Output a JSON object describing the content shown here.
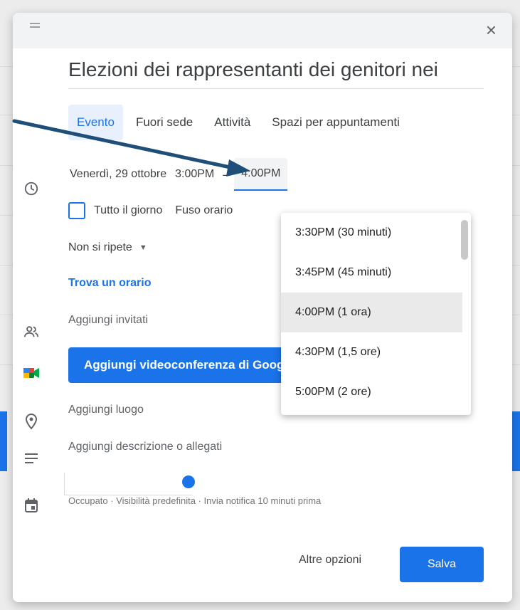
{
  "colors": {
    "accent": "#1a73e8",
    "arrow": "#1f4e79"
  },
  "header": {
    "close_label": "×"
  },
  "event": {
    "title": "Elezioni dei rappresentanti dei genitori nei"
  },
  "tabs": [
    {
      "label": "Evento",
      "active": true
    },
    {
      "label": "Fuori sede",
      "active": false
    },
    {
      "label": "Attività",
      "active": false
    },
    {
      "label": "Spazi per appuntamenti",
      "active": false
    }
  ],
  "datetime": {
    "date": "Venerdì, 29 ottobre",
    "start": "3:00PM",
    "separator": "–",
    "end": "4:00PM"
  },
  "allday": {
    "label": "Tutto il giorno",
    "timezone": "Fuso orario"
  },
  "repeat": {
    "label": "Non si ripete"
  },
  "find_time": {
    "label": "Trova un orario"
  },
  "guests": {
    "placeholder": "Aggiungi invitati"
  },
  "meet": {
    "label": "Aggiungi videoconferenza di Google Meet"
  },
  "location": {
    "placeholder": "Aggiungi luogo"
  },
  "description": {
    "placeholder": "Aggiungi descrizione o allegati"
  },
  "status": {
    "line": "Occupato · Visibilità predefinita · Invia notifica 10 minuti prima"
  },
  "footer": {
    "more_label": "Altre opzioni",
    "save_label": "Salva"
  },
  "end_time_options": [
    {
      "label": "3:30PM (30 minuti)",
      "selected": false
    },
    {
      "label": "3:45PM (45 minuti)",
      "selected": false
    },
    {
      "label": "4:00PM (1 ora)",
      "selected": true
    },
    {
      "label": "4:30PM (1,5 ore)",
      "selected": false
    },
    {
      "label": "5:00PM (2 ore)",
      "selected": false
    }
  ],
  "icons": {
    "clock": "clock-icon",
    "people": "people-icon",
    "meet": "google-meet-icon",
    "location": "location-pin-icon",
    "description": "notes-icon",
    "calendar": "calendar-icon"
  }
}
